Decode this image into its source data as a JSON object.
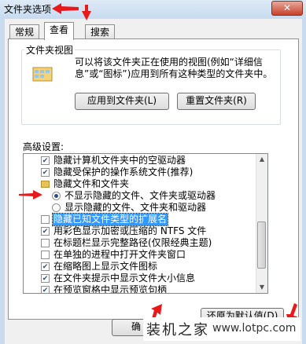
{
  "window": {
    "title": "文件夹选项",
    "close_glyph": "✕"
  },
  "tabs": [
    {
      "label": "常规"
    },
    {
      "label": "查看"
    },
    {
      "label": "搜索"
    }
  ],
  "folder_views": {
    "group_label": "文件夹视图",
    "description_line1": "可以将该文件夹正在使用的视图(例如“详细信",
    "description_line2": "息”或“图标”)应用到所有这种类型的文件夹中。",
    "apply_button": "应用到文件夹(L)",
    "reset_button": "重置文件夹(R)"
  },
  "advanced": {
    "label": "高级设置:",
    "items": [
      {
        "type": "checkbox",
        "checked": true,
        "label": "隐藏计算机文件夹中的空驱动器"
      },
      {
        "type": "checkbox",
        "checked": true,
        "label": "隐藏受保护的操作系统文件(推荐)"
      },
      {
        "type": "folder",
        "label": "隐藏文件和文件夹"
      },
      {
        "type": "radio",
        "checked": true,
        "label": "不显示隐藏的文件、文件夹或驱动器"
      },
      {
        "type": "radio",
        "checked": false,
        "label": "显示隐藏的文件、文件夹和驱动器"
      },
      {
        "type": "checkbox",
        "checked": false,
        "label": "隐藏已知文件类型的扩展名",
        "selected": true
      },
      {
        "type": "checkbox",
        "checked": true,
        "label": "用彩色显示加密或压缩的 NTFS 文件"
      },
      {
        "type": "checkbox",
        "checked": false,
        "label": "在标题栏显示完整路径(仅限经典主题)"
      },
      {
        "type": "checkbox",
        "checked": false,
        "label": "在单独的进程中打开文件夹窗口"
      },
      {
        "type": "checkbox",
        "checked": true,
        "label": "在缩略图上显示文件图标"
      },
      {
        "type": "checkbox",
        "checked": true,
        "label": "在文件夹提示中显示文件大小信息"
      },
      {
        "type": "checkbox",
        "checked": true,
        "label": "在预览窗格中显示预览句柄"
      }
    ],
    "restore_button": "还原为默认值(D)"
  },
  "bottom": {
    "ok_button_partial": "确"
  },
  "watermark": {
    "logo": "装机之家",
    "url": "www.lotpc.com"
  },
  "colors": {
    "arrow_red": "#e8191a",
    "selection": "#3399ff"
  },
  "icons": {
    "checkmark": "✔",
    "scroll_up": "▲",
    "scroll_down": "▼"
  }
}
